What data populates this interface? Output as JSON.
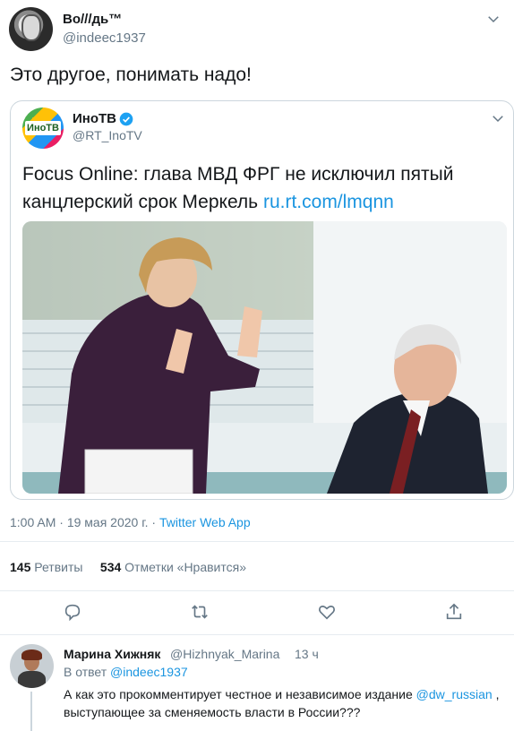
{
  "tweet": {
    "display_name": "Bo///дь™",
    "handle": "@indeec1937",
    "text": "Это другое, понимать надо!"
  },
  "quote": {
    "name": "ИноТВ",
    "handle": "@RT_InoTV",
    "avatar_logo": "ИноТВ",
    "text": "Focus Online: глава МВД ФРГ не исключил пятый канцлерский срок Меркель",
    "link": "ru.rt.com/lmqnn"
  },
  "meta": {
    "time": "1:00 AM",
    "separator": "·",
    "date": "19 мая 2020 г.",
    "app": "Twitter Web App"
  },
  "stats": {
    "retweets_count": "145",
    "retweets_label": "Ретвиты",
    "likes_count": "534",
    "likes_label": "Отметки «Нравится»"
  },
  "actions": [
    "reply-icon",
    "retweet-icon",
    "like-icon",
    "share-icon"
  ],
  "reply": {
    "name": "Марина Хижняк",
    "handle": "@Hizhnyak_Marina",
    "time": "13 ч",
    "reply_to_label": "В ответ",
    "reply_to_handle": "@indeec1937",
    "text_before": "А как это прокомментирует честное и независимое издание",
    "mention": "@dw_russian",
    "text_after": ", выступающее за сменяемость власти в России???"
  },
  "colors": {
    "link": "#1b95e0",
    "muted": "#657786",
    "text": "#14171a",
    "border": "#ccd6dd"
  }
}
